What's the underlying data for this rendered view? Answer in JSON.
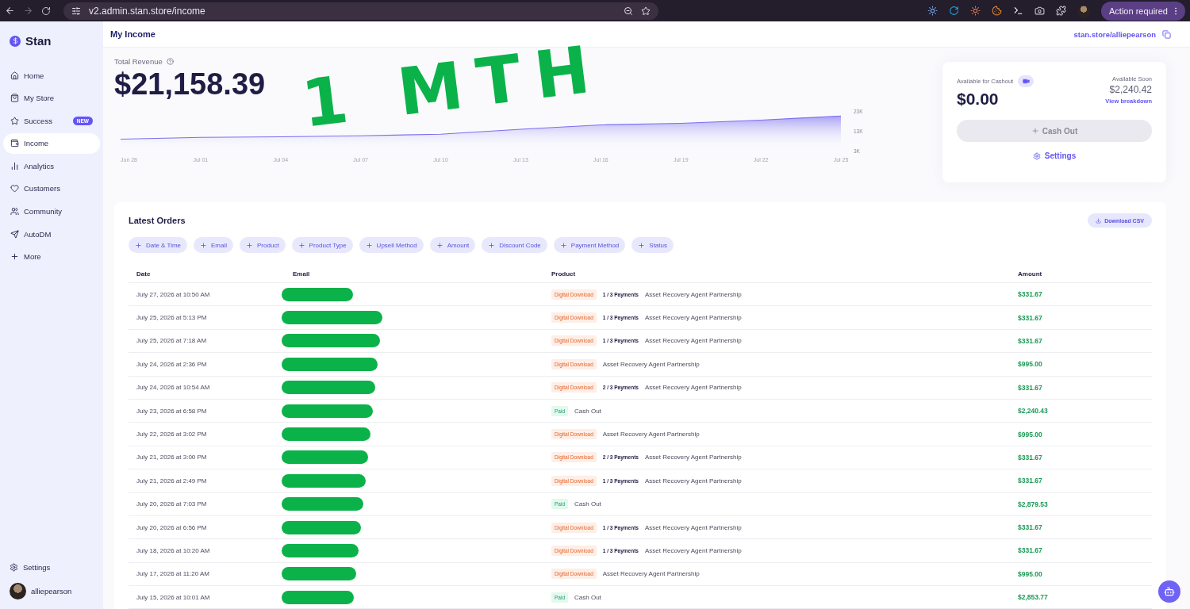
{
  "browser": {
    "url": "v2.admin.stan.store/income",
    "action": "Action required"
  },
  "sidebar": {
    "brand": "Stan",
    "items": [
      {
        "label": "Home",
        "selected": false
      },
      {
        "label": "My Store",
        "selected": false
      },
      {
        "label": "Success",
        "selected": false,
        "badge": "NEW"
      },
      {
        "label": "Income",
        "selected": true
      },
      {
        "label": "Analytics",
        "selected": false
      },
      {
        "label": "Customers",
        "selected": false
      },
      {
        "label": "Community",
        "selected": false
      },
      {
        "label": "AutoDM",
        "selected": false
      },
      {
        "label": "More",
        "selected": false
      }
    ],
    "settings": "Settings",
    "user": "alliepearson"
  },
  "header": {
    "title": "My Income",
    "store_link": "stan.store/alliepearson"
  },
  "revenue": {
    "label": "Total Revenue",
    "amount": "$21,158.39",
    "chart_data": {
      "type": "area",
      "categories": [
        "Jun 28",
        "Jul 01",
        "Jul 04",
        "Jul 07",
        "Jul 10",
        "Jul 13",
        "Jul 16",
        "Jul 19",
        "Jul 22",
        "Jul 25"
      ],
      "series": [
        {
          "color": "#7b6ef0",
          "values": [
            8800,
            9700,
            10000,
            10500,
            11300,
            13800,
            16000,
            16800,
            18400,
            20500
          ]
        }
      ],
      "ylim": [
        3000,
        23000
      ],
      "yticks": [
        {
          "value": 23000,
          "label": "23K"
        },
        {
          "value": 13000,
          "label": "13K"
        },
        {
          "value": 3000,
          "label": "3K"
        }
      ]
    }
  },
  "cashout": {
    "label": "Available for Cashout",
    "amount": "$0.00",
    "soon_label": "Available Soon",
    "soon_amount": "$2,240.42",
    "breakdown": "View breakdown",
    "button": "Cash Out",
    "settings": "Settings"
  },
  "annotation": {
    "text": "1 MTH"
  },
  "orders": {
    "title": "Latest Orders",
    "download": "Download CSV",
    "filters": [
      "Date & Time",
      "Email",
      "Product",
      "Product Type",
      "Upsell Method",
      "Amount",
      "Discount Code",
      "Payment Method",
      "Status"
    ],
    "columns": [
      "Date",
      "Email",
      "Product",
      "Amount"
    ],
    "rows": [
      {
        "date": "July 27, 2026 at 10:50 AM",
        "email_redacted": true,
        "kind": "download",
        "tag": "Digital Download",
        "payments": "1 / 3 Payments",
        "product": "Asset Recovery Agent Partnership",
        "amount": "$331.67"
      },
      {
        "date": "July 25, 2026 at 5:13 PM",
        "email_redacted": true,
        "kind": "download",
        "tag": "Digital Download",
        "payments": "1 / 3 Payments",
        "product": "Asset Recovery Agent Partnership",
        "amount": "$331.67"
      },
      {
        "date": "July 25, 2026 at 7:18 AM",
        "email_redacted": true,
        "kind": "download",
        "tag": "Digital Download",
        "payments": "1 / 3 Payments",
        "product": "Asset Recovery Agent Partnership",
        "amount": "$331.67"
      },
      {
        "date": "July 24, 2026 at 2:36 PM",
        "email_redacted": true,
        "kind": "download",
        "tag": "Digital Download",
        "product": "Asset Recovery Agent Partnership",
        "amount": "$995.00"
      },
      {
        "date": "July 24, 2026 at 10:54 AM",
        "email_redacted": true,
        "kind": "download",
        "tag": "Digital Download",
        "payments": "2 / 3 Payments",
        "product": "Asset Recovery Agent Partnership",
        "amount": "$331.67"
      },
      {
        "date": "July 23, 2026 at 6:58 PM",
        "email_redacted": true,
        "kind": "paid",
        "tag": "Paid",
        "product": "Cash Out",
        "amount": "$2,240.43"
      },
      {
        "date": "July 22, 2026 at 3:02 PM",
        "email_redacted": true,
        "kind": "download",
        "tag": "Digital Download",
        "product": "Asset Recovery Agent Partnership",
        "amount": "$995.00"
      },
      {
        "date": "July 21, 2026 at 3:00 PM",
        "email_redacted": true,
        "kind": "download",
        "tag": "Digital Download",
        "payments": "2 / 3 Payments",
        "product": "Asset Recovery Agent Partnership",
        "amount": "$331.67"
      },
      {
        "date": "July 21, 2026 at 2:49 PM",
        "email_redacted": true,
        "kind": "download",
        "tag": "Digital Download",
        "payments": "1 / 3 Payments",
        "product": "Asset Recovery Agent Partnership",
        "amount": "$331.67"
      },
      {
        "date": "July 20, 2026 at 7:03 PM",
        "email_redacted": true,
        "kind": "paid",
        "tag": "Paid",
        "product": "Cash Out",
        "amount": "$2,879.53"
      },
      {
        "date": "July 20, 2026 at 6:56 PM",
        "email_redacted": true,
        "kind": "download",
        "tag": "Digital Download",
        "payments": "1 / 3 Payments",
        "product": "Asset Recovery Agent Partnership",
        "amount": "$331.67"
      },
      {
        "date": "July 18, 2026 at 10:20 AM",
        "email_redacted": true,
        "kind": "download",
        "tag": "Digital Download",
        "payments": "1 / 3 Payments",
        "product": "Asset Recovery Agent Partnership",
        "amount": "$331.67"
      },
      {
        "date": "July 17, 2026 at 11:20 AM",
        "email_redacted": true,
        "kind": "download",
        "tag": "Digital Download",
        "product": "Asset Recovery Agent Partnership",
        "amount": "$995.00"
      },
      {
        "date": "July 15, 2026 at 10:01 AM",
        "email_redacted": true,
        "kind": "paid",
        "tag": "Paid",
        "product": "Cash Out",
        "amount": "$2,853.77"
      }
    ]
  }
}
